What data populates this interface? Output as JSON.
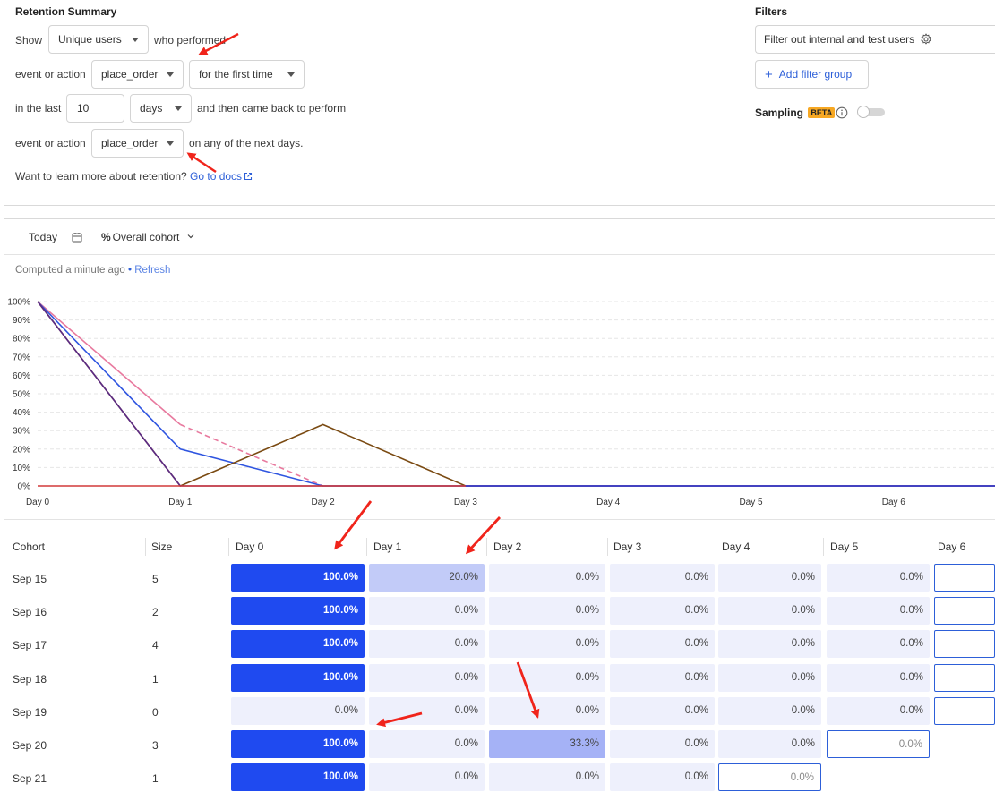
{
  "summary": {
    "title": "Retention Summary",
    "show_label": "Show",
    "show_value": "Unique users",
    "who_performed": "who performed",
    "event_label_1": "event or action",
    "event_value_1": "place_order",
    "first_time_value": "for the first time",
    "in_last_label": "in the last",
    "period_value": "10",
    "unit_value": "days",
    "came_back_text": "and then came back to perform",
    "event_label_2": "event or action",
    "event_value_2": "place_order",
    "next_days_text": "on any of the next days.",
    "learn_text": "Want to learn more about retention?",
    "docs_link": "Go to docs"
  },
  "filters": {
    "title": "Filters",
    "filter_internal": "Filter out internal and test users",
    "add_group": "Add filter group",
    "sampling": "Sampling",
    "beta": "BETA"
  },
  "toolbar": {
    "date": "Today",
    "cohort_mode": "Overall cohort",
    "computed": "Computed a minute ago",
    "bullet": "•",
    "refresh": "Refresh"
  },
  "chart_data": {
    "type": "line",
    "x": [
      "Day 0",
      "Day 1",
      "Day 2",
      "Day 3",
      "Day 4",
      "Day 5",
      "Day 6"
    ],
    "ylim": [
      0,
      100
    ],
    "y_ticks": [
      "0%",
      "10%",
      "20%",
      "30%",
      "40%",
      "50%",
      "60%",
      "70%",
      "80%",
      "90%",
      "100%"
    ],
    "grid": true,
    "series": [
      {
        "color": "#e8799e",
        "values": [
          100,
          33.3,
          0,
          0,
          0,
          0,
          0
        ],
        "dashed_from": 1
      },
      {
        "color": "#2f55e0",
        "values": [
          100,
          20,
          0,
          0,
          0,
          0,
          0
        ]
      },
      {
        "color": "#7a4a12",
        "values": [
          100,
          0,
          33.3,
          0,
          0,
          0,
          0
        ]
      },
      {
        "color": "#5b2a86",
        "values": [
          100,
          0,
          0,
          0,
          0,
          0,
          0
        ]
      },
      {
        "color": "#d23a3a",
        "values": [
          0,
          0,
          0,
          0,
          0,
          0,
          0
        ]
      },
      {
        "color": "#2642e0",
        "values": [
          null,
          null,
          null,
          0,
          0,
          0,
          0
        ]
      }
    ]
  },
  "table": {
    "headers": [
      "Cohort",
      "Size",
      "Day 0",
      "Day 1",
      "Day 2",
      "Day 3",
      "Day 4",
      "Day 5",
      "Day 6"
    ],
    "rows": [
      {
        "cohort": "Sep 15",
        "size": "5",
        "cells": [
          "100.0%",
          "20.0%",
          "0.0%",
          "0.0%",
          "0.0%",
          "0.0%",
          ""
        ]
      },
      {
        "cohort": "Sep 16",
        "size": "2",
        "cells": [
          "100.0%",
          "0.0%",
          "0.0%",
          "0.0%",
          "0.0%",
          "0.0%",
          ""
        ]
      },
      {
        "cohort": "Sep 17",
        "size": "4",
        "cells": [
          "100.0%",
          "0.0%",
          "0.0%",
          "0.0%",
          "0.0%",
          "0.0%",
          ""
        ]
      },
      {
        "cohort": "Sep 18",
        "size": "1",
        "cells": [
          "100.0%",
          "0.0%",
          "0.0%",
          "0.0%",
          "0.0%",
          "0.0%",
          ""
        ]
      },
      {
        "cohort": "Sep 19",
        "size": "0",
        "cells": [
          "0.0%",
          "0.0%",
          "0.0%",
          "0.0%",
          "0.0%",
          "0.0%",
          ""
        ]
      },
      {
        "cohort": "Sep 20",
        "size": "3",
        "cells": [
          "100.0%",
          "0.0%",
          "33.3%",
          "0.0%",
          "0.0%",
          "0.0%"
        ]
      },
      {
        "cohort": "Sep 21",
        "size": "1",
        "cells": [
          "100.0%",
          "0.0%",
          "0.0%",
          "0.0%",
          "0.0%"
        ]
      }
    ]
  },
  "colors": {
    "full": "#1f4af0",
    "light": "#eef0fc",
    "mid20": "#c2cbf8",
    "mid33": "#a5b2f6",
    "accent": "#2d5fd8"
  }
}
